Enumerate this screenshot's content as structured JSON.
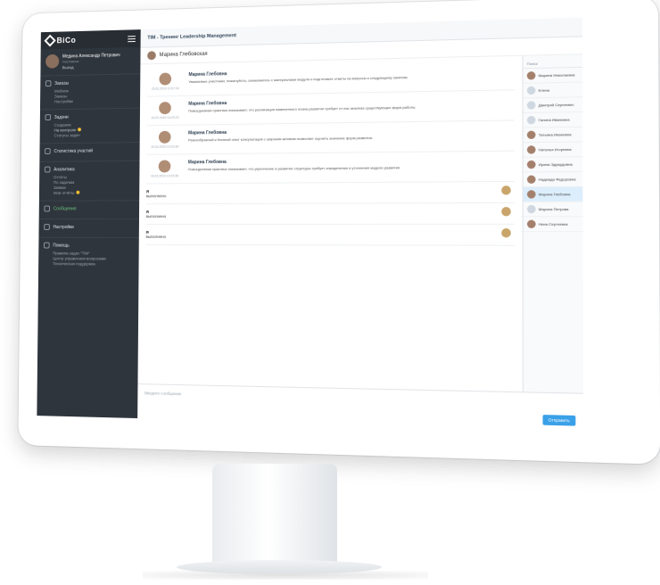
{
  "app": {
    "logo": "BiCo",
    "window_title": "TIM - Тренинг Leadership Management"
  },
  "sidebar": {
    "user_name": "Медина Александр Петрович",
    "user_sub": "Наставник",
    "logout": "Выход",
    "sections": [
      {
        "label": "Заказы",
        "items": [
          "Мобили",
          "Заказы",
          "Настройки"
        ]
      },
      {
        "label": "Задачи",
        "items": [
          "Создание",
          "На контроле",
          "Статусы задач"
        ]
      },
      {
        "label": "Статистика участий",
        "items": []
      },
      {
        "label": "Аналитика",
        "items": [
          "Отчёты",
          "По задачам",
          "Заявки",
          "Мои отчёты"
        ]
      }
    ],
    "active_item": "Сообщения",
    "settings": "Настройки",
    "help_label": "Помощь",
    "help_items": [
      "Правила задач \"TIM\"",
      "Центр управления вопросами",
      "Техническая поддержка"
    ]
  },
  "chat": {
    "title": "Марина Глебовская",
    "messages": [
      {
        "author": "Марина Глебовна",
        "time": "15.02.2019 11:57:16",
        "text": "Уважаемые участники, пожалуйста, ознакомьтесь с материалами модуля и подготовьте ответы на вопросы к следующему занятию."
      },
      {
        "author": "Марина Глебовна",
        "time": "19.02.2019 14:23:15",
        "text": "Повседневная практика показывает, что реализация намеченного плана развития требует от нас анализа существующих форм работы."
      },
      {
        "author": "Марина Глебовна",
        "time": "19.02.2019 14:23:30",
        "text": "Разнообразный и богатый опыт консультация с широким активом позволяет оценить значение форм развития."
      },
      {
        "author": "Марина Глебовна",
        "time": "19.02.2019 14:23:36",
        "text": "Повседневная практика показывает, что укрепление и развитие структуры требует определения и уточнения модели развития."
      }
    ],
    "replies": [
      {
        "letter": "Я",
        "text": "выполнено"
      },
      {
        "letter": "Я",
        "text": "выполнено"
      },
      {
        "letter": "Я",
        "text": "выполнено"
      }
    ],
    "input_placeholder": "Введите сообщение",
    "send_label": "Отправить"
  },
  "contacts": {
    "header": "Поиск",
    "items": [
      "Марина Николаевна",
      "Елена",
      "Дмитрий Сергеевич",
      "Галина Ивановна",
      "Татьяна Ивановна",
      "Наталья Игоревна",
      "Ирина Эдуардовна",
      "Надежда Федоровна",
      "Марина Глебовна",
      "Марина Петрова",
      "Нина Сергеевна"
    ],
    "active_index": 8
  }
}
